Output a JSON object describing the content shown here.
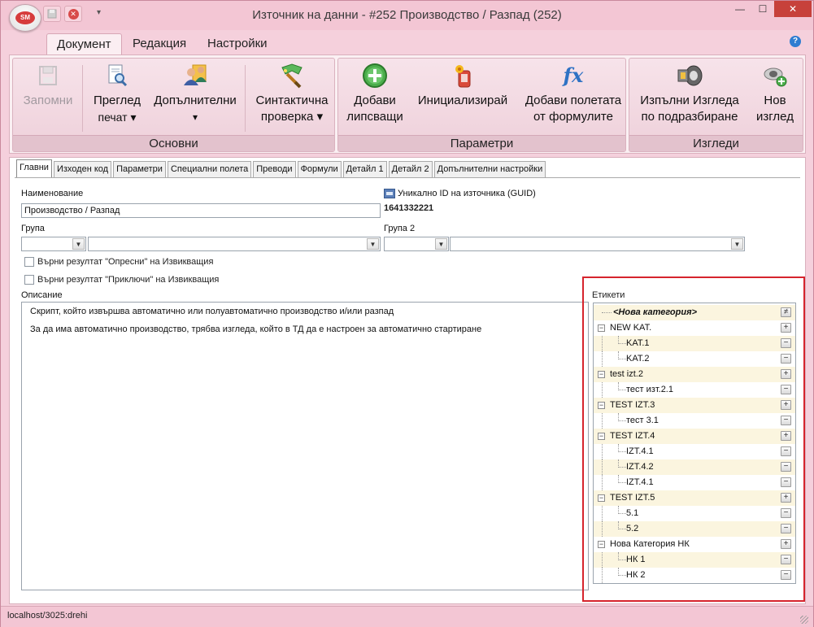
{
  "window": {
    "title": "Източник на данни - #252 Производство / Разпад (252)",
    "logo_text": "SM",
    "controls": {
      "minimize": "—",
      "maximize": "☐",
      "close": "✕"
    }
  },
  "ribbon": {
    "tabs": [
      "Документ",
      "Редакция",
      "Настройки"
    ],
    "active_tab": "Документ",
    "groups": [
      {
        "label": "Основни",
        "buttons": [
          {
            "line1": "Запомни",
            "line2": "",
            "disabled": true
          },
          {
            "line1": "Преглед",
            "line2": "печат ▾"
          },
          {
            "line1": "Допълнителни",
            "line2": "▾"
          },
          {
            "line1": "Синтактична",
            "line2": "проверка ▾"
          }
        ]
      },
      {
        "label": "Параметри",
        "buttons": [
          {
            "line1": "Добави",
            "line2": "липсващи"
          },
          {
            "line1": "Инициализирай",
            "line2": ""
          },
          {
            "line1": "Добави полетата",
            "line2": "от формулите"
          }
        ]
      },
      {
        "label": "Изгледи",
        "buttons": [
          {
            "line1": "Изпълни Изгледа",
            "line2": "по подразбиране"
          },
          {
            "line1": "Нов",
            "line2": "изглед"
          }
        ]
      }
    ]
  },
  "tabs": [
    "Главни",
    "Изходен код",
    "Параметри",
    "Специални полета",
    "Преводи",
    "Формули",
    "Детайл 1",
    "Детайл 2",
    "Допълнителни настройки"
  ],
  "form": {
    "name_label": "Наименование",
    "name_value": "Производство / Разпад",
    "guid_label": "Уникално ID на източника (GUID)",
    "guid_value": "1641332221",
    "group_label": "Група",
    "group2_label": "Група 2",
    "check1": "Върни резултат \"Опресни\" на Извикващия",
    "check2": "Върни резултат \"Приключи\" на Извикващия",
    "desc_label": "Описание",
    "desc_lines": [
      "Скрипт, който извършва автоматично или полуавтоматично производство и/или разпад",
      "За да има автоматично производство, трябва изгледа, който в ТД да е настроен за автоматично стартиране"
    ]
  },
  "tags": {
    "label": "Етикети",
    "new_category": "<Нова категория>",
    "categories": [
      {
        "name": "NEW KAT.",
        "items": [
          "KAT.1",
          "KAT.2"
        ]
      },
      {
        "name": "test izt.2",
        "items": [
          "тест изт.2.1"
        ]
      },
      {
        "name": "TEST IZT.3",
        "items": [
          "тест 3.1"
        ]
      },
      {
        "name": "TEST IZT.4",
        "items": [
          "IZT.4.1",
          "IZT.4.2",
          "IZT.4.1"
        ]
      },
      {
        "name": "TEST IZT.5",
        "items": [
          "5.1",
          "5.2"
        ]
      },
      {
        "name": "Нова Категория НК",
        "items": [
          "НК 1",
          "НК 2"
        ]
      }
    ]
  },
  "status": {
    "text": "localhost/3025:drehi"
  }
}
